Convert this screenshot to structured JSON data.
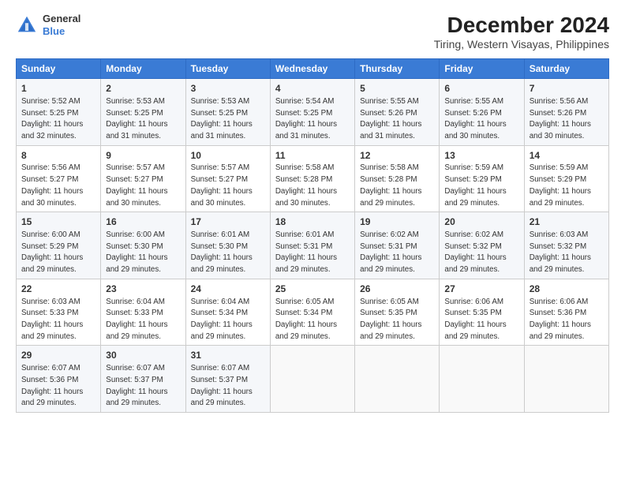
{
  "logo": {
    "line1": "General",
    "line2": "Blue"
  },
  "title": "December 2024",
  "subtitle": "Tiring, Western Visayas, Philippines",
  "days_of_week": [
    "Sunday",
    "Monday",
    "Tuesday",
    "Wednesday",
    "Thursday",
    "Friday",
    "Saturday"
  ],
  "weeks": [
    [
      {
        "day": "1",
        "info": "Sunrise: 5:52 AM\nSunset: 5:25 PM\nDaylight: 11 hours\nand 32 minutes."
      },
      {
        "day": "2",
        "info": "Sunrise: 5:53 AM\nSunset: 5:25 PM\nDaylight: 11 hours\nand 31 minutes."
      },
      {
        "day": "3",
        "info": "Sunrise: 5:53 AM\nSunset: 5:25 PM\nDaylight: 11 hours\nand 31 minutes."
      },
      {
        "day": "4",
        "info": "Sunrise: 5:54 AM\nSunset: 5:25 PM\nDaylight: 11 hours\nand 31 minutes."
      },
      {
        "day": "5",
        "info": "Sunrise: 5:55 AM\nSunset: 5:26 PM\nDaylight: 11 hours\nand 31 minutes."
      },
      {
        "day": "6",
        "info": "Sunrise: 5:55 AM\nSunset: 5:26 PM\nDaylight: 11 hours\nand 30 minutes."
      },
      {
        "day": "7",
        "info": "Sunrise: 5:56 AM\nSunset: 5:26 PM\nDaylight: 11 hours\nand 30 minutes."
      }
    ],
    [
      {
        "day": "8",
        "info": "Sunrise: 5:56 AM\nSunset: 5:27 PM\nDaylight: 11 hours\nand 30 minutes."
      },
      {
        "day": "9",
        "info": "Sunrise: 5:57 AM\nSunset: 5:27 PM\nDaylight: 11 hours\nand 30 minutes."
      },
      {
        "day": "10",
        "info": "Sunrise: 5:57 AM\nSunset: 5:27 PM\nDaylight: 11 hours\nand 30 minutes."
      },
      {
        "day": "11",
        "info": "Sunrise: 5:58 AM\nSunset: 5:28 PM\nDaylight: 11 hours\nand 30 minutes."
      },
      {
        "day": "12",
        "info": "Sunrise: 5:58 AM\nSunset: 5:28 PM\nDaylight: 11 hours\nand 29 minutes."
      },
      {
        "day": "13",
        "info": "Sunrise: 5:59 AM\nSunset: 5:29 PM\nDaylight: 11 hours\nand 29 minutes."
      },
      {
        "day": "14",
        "info": "Sunrise: 5:59 AM\nSunset: 5:29 PM\nDaylight: 11 hours\nand 29 minutes."
      }
    ],
    [
      {
        "day": "15",
        "info": "Sunrise: 6:00 AM\nSunset: 5:29 PM\nDaylight: 11 hours\nand 29 minutes."
      },
      {
        "day": "16",
        "info": "Sunrise: 6:00 AM\nSunset: 5:30 PM\nDaylight: 11 hours\nand 29 minutes."
      },
      {
        "day": "17",
        "info": "Sunrise: 6:01 AM\nSunset: 5:30 PM\nDaylight: 11 hours\nand 29 minutes."
      },
      {
        "day": "18",
        "info": "Sunrise: 6:01 AM\nSunset: 5:31 PM\nDaylight: 11 hours\nand 29 minutes."
      },
      {
        "day": "19",
        "info": "Sunrise: 6:02 AM\nSunset: 5:31 PM\nDaylight: 11 hours\nand 29 minutes."
      },
      {
        "day": "20",
        "info": "Sunrise: 6:02 AM\nSunset: 5:32 PM\nDaylight: 11 hours\nand 29 minutes."
      },
      {
        "day": "21",
        "info": "Sunrise: 6:03 AM\nSunset: 5:32 PM\nDaylight: 11 hours\nand 29 minutes."
      }
    ],
    [
      {
        "day": "22",
        "info": "Sunrise: 6:03 AM\nSunset: 5:33 PM\nDaylight: 11 hours\nand 29 minutes."
      },
      {
        "day": "23",
        "info": "Sunrise: 6:04 AM\nSunset: 5:33 PM\nDaylight: 11 hours\nand 29 minutes."
      },
      {
        "day": "24",
        "info": "Sunrise: 6:04 AM\nSunset: 5:34 PM\nDaylight: 11 hours\nand 29 minutes."
      },
      {
        "day": "25",
        "info": "Sunrise: 6:05 AM\nSunset: 5:34 PM\nDaylight: 11 hours\nand 29 minutes."
      },
      {
        "day": "26",
        "info": "Sunrise: 6:05 AM\nSunset: 5:35 PM\nDaylight: 11 hours\nand 29 minutes."
      },
      {
        "day": "27",
        "info": "Sunrise: 6:06 AM\nSunset: 5:35 PM\nDaylight: 11 hours\nand 29 minutes."
      },
      {
        "day": "28",
        "info": "Sunrise: 6:06 AM\nSunset: 5:36 PM\nDaylight: 11 hours\nand 29 minutes."
      }
    ],
    [
      {
        "day": "29",
        "info": "Sunrise: 6:07 AM\nSunset: 5:36 PM\nDaylight: 11 hours\nand 29 minutes."
      },
      {
        "day": "30",
        "info": "Sunrise: 6:07 AM\nSunset: 5:37 PM\nDaylight: 11 hours\nand 29 minutes."
      },
      {
        "day": "31",
        "info": "Sunrise: 6:07 AM\nSunset: 5:37 PM\nDaylight: 11 hours\nand 29 minutes."
      },
      {
        "day": "",
        "info": ""
      },
      {
        "day": "",
        "info": ""
      },
      {
        "day": "",
        "info": ""
      },
      {
        "day": "",
        "info": ""
      }
    ]
  ]
}
